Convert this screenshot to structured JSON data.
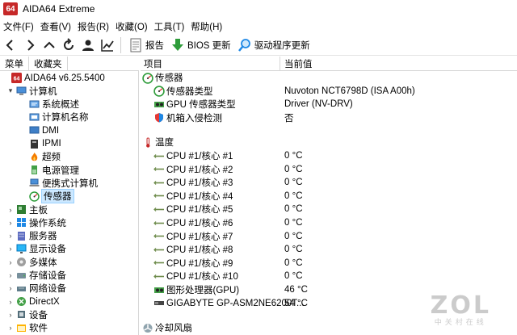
{
  "window": {
    "app_logo": "64",
    "title": "AIDA64 Extreme"
  },
  "menu": [
    "文件(F)",
    "查看(V)",
    "报告(R)",
    "收藏(O)",
    "工具(T)",
    "帮助(H)"
  ],
  "toolbar": {
    "nav_icons": [
      "back-icon",
      "forward-icon",
      "up-icon",
      "refresh-icon",
      "user-icon",
      "chart-icon"
    ],
    "report_label": "报告",
    "bios_label": "BIOS 更新",
    "driver_label": "驱动程序更新"
  },
  "left_tabs": [
    "菜单",
    "收藏夹"
  ],
  "tree": [
    {
      "label": "AIDA64 v6.25.5400",
      "level": 0,
      "icon": "aida-logo-icon",
      "expander": ""
    },
    {
      "label": "计算机",
      "level": 1,
      "icon": "computer-icon",
      "expander": "▾"
    },
    {
      "label": "系统概述",
      "level": 2,
      "icon": "summary-icon",
      "expander": ""
    },
    {
      "label": "计算机名称",
      "level": 2,
      "icon": "computer-name-icon",
      "expander": ""
    },
    {
      "label": "DMI",
      "level": 2,
      "icon": "dmi-icon",
      "expander": ""
    },
    {
      "label": "IPMI",
      "level": 2,
      "icon": "ipmi-icon",
      "expander": ""
    },
    {
      "label": "超频",
      "level": 2,
      "icon": "fire-icon",
      "expander": ""
    },
    {
      "label": "电源管理",
      "level": 2,
      "icon": "power-icon",
      "expander": ""
    },
    {
      "label": "便携式计算机",
      "level": 2,
      "icon": "laptop-icon",
      "expander": ""
    },
    {
      "label": "传感器",
      "level": 2,
      "icon": "sensor-gauge-icon",
      "expander": "",
      "selected": true
    },
    {
      "label": "主板",
      "level": 1,
      "icon": "motherboard-icon",
      "expander": "›"
    },
    {
      "label": "操作系统",
      "level": 1,
      "icon": "windows-icon",
      "expander": "›"
    },
    {
      "label": "服务器",
      "level": 1,
      "icon": "server-icon",
      "expander": "›"
    },
    {
      "label": "显示设备",
      "level": 1,
      "icon": "display-icon",
      "expander": "›"
    },
    {
      "label": "多媒体",
      "level": 1,
      "icon": "multimedia-icon",
      "expander": "›"
    },
    {
      "label": "存储设备",
      "level": 1,
      "icon": "storage-icon",
      "expander": "›"
    },
    {
      "label": "网络设备",
      "level": 1,
      "icon": "network-icon",
      "expander": "›"
    },
    {
      "label": "DirectX",
      "level": 1,
      "icon": "directx-icon",
      "expander": "›"
    },
    {
      "label": "设备",
      "level": 1,
      "icon": "devices-icon",
      "expander": "›"
    },
    {
      "label": "软件",
      "level": 1,
      "icon": "software-icon",
      "expander": "›"
    }
  ],
  "columns": {
    "item": "项目",
    "value": "当前值"
  },
  "rows": [
    {
      "type": "group",
      "label": "传感器",
      "icon": "sensor-gauge-icon"
    },
    {
      "type": "item",
      "label": "传感器类型",
      "value": "Nuvoton NCT6798D  (ISA A00h)",
      "icon": "sensor-gauge-icon"
    },
    {
      "type": "item",
      "label": "GPU 传感器类型",
      "value": "Driver  (NV-DRV)",
      "icon": "gpu-icon"
    },
    {
      "type": "item",
      "label": "机箱入侵检测",
      "value": "否",
      "icon": "shield-icon"
    },
    {
      "type": "spacer"
    },
    {
      "type": "group",
      "label": "温度",
      "icon": "thermometer-icon"
    },
    {
      "type": "item",
      "label": "CPU #1/核心 #1",
      "value": "0 °C",
      "icon": "cpu-core-icon"
    },
    {
      "type": "item",
      "label": "CPU #1/核心 #2",
      "value": "0 °C",
      "icon": "cpu-core-icon"
    },
    {
      "type": "item",
      "label": "CPU #1/核心 #3",
      "value": "0 °C",
      "icon": "cpu-core-icon"
    },
    {
      "type": "item",
      "label": "CPU #1/核心 #4",
      "value": "0 °C",
      "icon": "cpu-core-icon"
    },
    {
      "type": "item",
      "label": "CPU #1/核心 #5",
      "value": "0 °C",
      "icon": "cpu-core-icon"
    },
    {
      "type": "item",
      "label": "CPU #1/核心 #6",
      "value": "0 °C",
      "icon": "cpu-core-icon"
    },
    {
      "type": "item",
      "label": "CPU #1/核心 #7",
      "value": "0 °C",
      "icon": "cpu-core-icon"
    },
    {
      "type": "item",
      "label": "CPU #1/核心 #8",
      "value": "0 °C",
      "icon": "cpu-core-icon"
    },
    {
      "type": "item",
      "label": "CPU #1/核心 #9",
      "value": "0 °C",
      "icon": "cpu-core-icon"
    },
    {
      "type": "item",
      "label": "CPU #1/核心 #10",
      "value": "0 °C",
      "icon": "cpu-core-icon"
    },
    {
      "type": "item",
      "label": "图形处理器(GPU)",
      "value": "46 °C",
      "icon": "gpu-icon"
    },
    {
      "type": "item",
      "label": "GIGABYTE GP-ASM2NE6200T...",
      "value": "54 °C",
      "icon": "ssd-icon"
    },
    {
      "type": "spacer"
    },
    {
      "type": "group",
      "label": "冷却风扇",
      "icon": "fan-icon"
    }
  ],
  "watermark": {
    "big": "ZOL",
    "small": "中关村在线"
  },
  "colors": {
    "selection": "#cce8ff",
    "logo_red": "#c62828",
    "accent_green": "#2e9c3a",
    "accent_blue": "#1e88e5"
  }
}
